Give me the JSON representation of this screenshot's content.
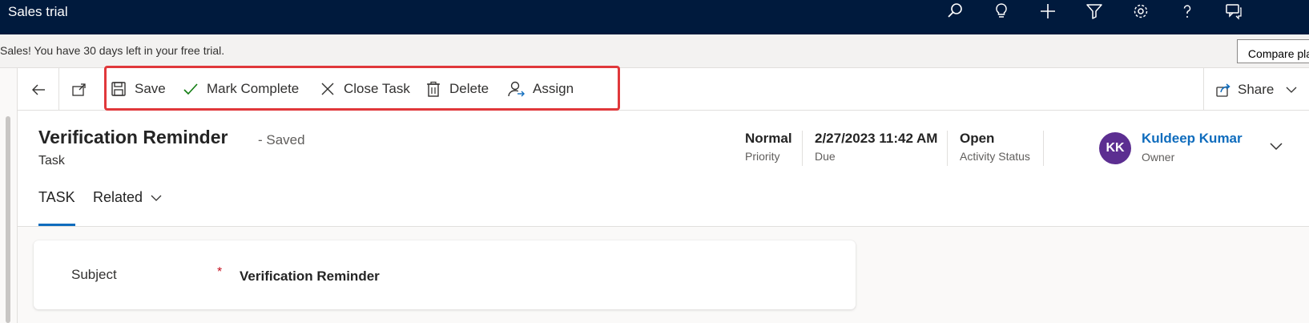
{
  "app": {
    "title": "Sales trial"
  },
  "topbar": {
    "icons": [
      "search-icon",
      "lightbulb-icon",
      "add-icon",
      "filter-icon",
      "settings-icon",
      "help-icon",
      "chat-icon"
    ]
  },
  "banner": {
    "message": "Sales! You have 30 days left in your free trial.",
    "compare_label": "Compare pla"
  },
  "commandbar": {
    "save": "Save",
    "mark_complete": "Mark Complete",
    "close_task": "Close Task",
    "delete": "Delete",
    "assign": "Assign",
    "share": "Share",
    "highlight_color": "#e0383b"
  },
  "record": {
    "title": "Verification Reminder",
    "saved_status": "- Saved",
    "entity": "Task",
    "priority": {
      "value": "Normal",
      "label": "Priority"
    },
    "due": {
      "value": "2/27/2023 11:42 AM",
      "label": "Due"
    },
    "status": {
      "value": "Open",
      "label": "Activity Status"
    },
    "owner": {
      "initials": "KK",
      "name": "Kuldeep Kumar",
      "label": "Owner",
      "avatar_color": "#5c2e91"
    }
  },
  "tabs": [
    {
      "label": "TASK",
      "selected": true
    },
    {
      "label": "Related",
      "selected": false
    }
  ],
  "form": {
    "subject_label": "Subject",
    "required_mark": "*",
    "subject_value": "Verification Reminder"
  }
}
